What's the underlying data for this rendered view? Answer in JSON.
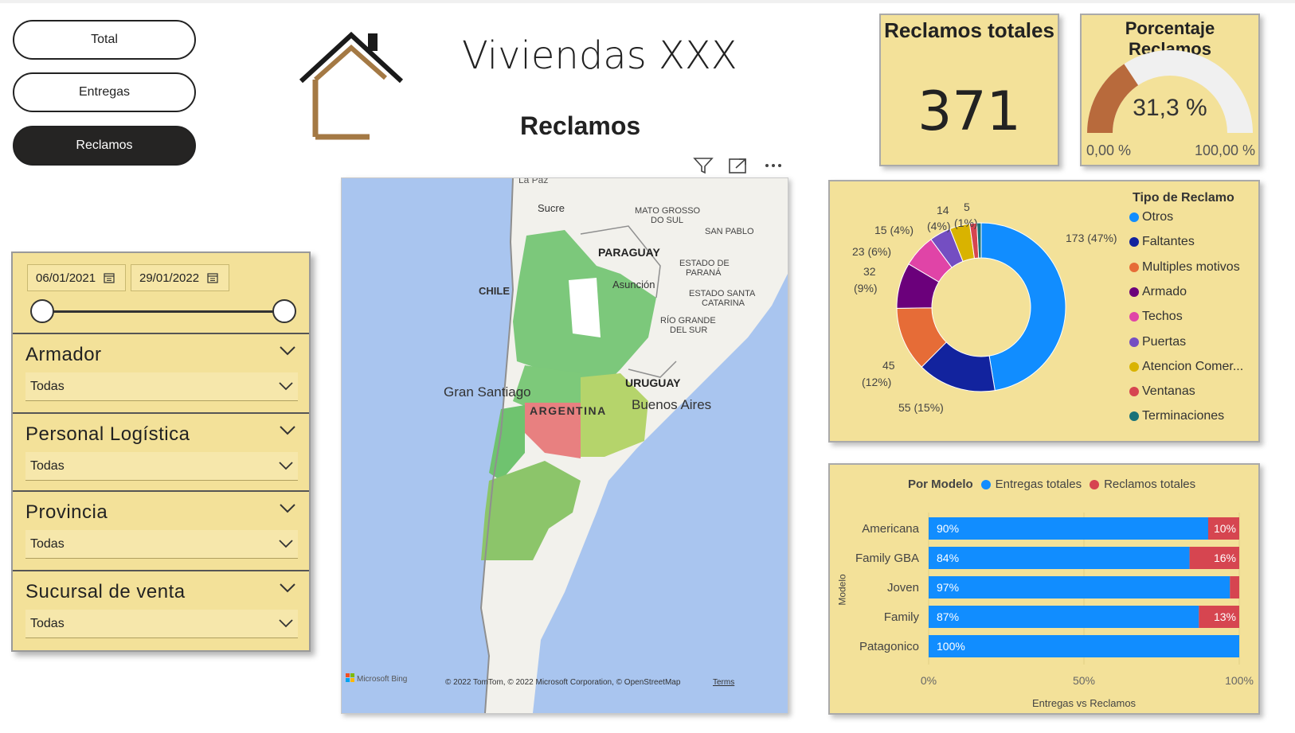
{
  "nav": {
    "total_label": "Total",
    "entregas_label": "Entregas",
    "reclamos_label": "Reclamos"
  },
  "header": {
    "title": "Viviendas XXX",
    "subtitle": "Reclamos"
  },
  "filters": {
    "date_start": "06/01/2021",
    "date_end": "29/01/2022",
    "sections": [
      {
        "label": "Armador",
        "value": "Todas"
      },
      {
        "label": "Personal Logística",
        "value": "Todas"
      },
      {
        "label": "Provincia",
        "value": "Todas"
      },
      {
        "label": "Sucursal de venta",
        "value": "Todas"
      }
    ]
  },
  "map": {
    "labels": {
      "la_paz": "La Paz",
      "sucre": "Sucre",
      "mato_grosso_1": "MATO GROSSO",
      "mato_grosso_2": "DO SUL",
      "san_pablo": "SAN PABLO",
      "paraguay": "PARAGUAY",
      "estado_parana_1": "ESTADO DE",
      "estado_parana_2": "PARANÁ",
      "asuncion": "Asunción",
      "chile": "CHILE",
      "santa_catarina_1": "ESTADO SANTA",
      "santa_catarina_2": "CATARINA",
      "rio_grande_1": "RÍO GRANDE",
      "rio_grande_2": "DEL SUR",
      "uruguay": "URUGUAY",
      "gran_santiago": "Gran Santiago",
      "argentina": "ARGENTINA",
      "buenos_aires": "Buenos Aires",
      "bing": "Microsoft Bing",
      "copyright": "© 2022 TomTom, © 2022 Microsoft Corporation, © OpenStreetMap",
      "terms": "Terms"
    }
  },
  "kpi": {
    "title": "Reclamos totales",
    "value": "371"
  },
  "gauge": {
    "title": "Porcentaje Reclamos",
    "value_label": "31,3 %",
    "value": 0.313,
    "min_label": "0,00 %",
    "max_label": "100,00 %",
    "fill_color": "#b86a3c",
    "track_color": "#f0f0f0"
  },
  "donut": {
    "legend_title": "Tipo de Reclamo",
    "colors": {
      "otros": "#118dff",
      "faltantes": "#12239e",
      "multiples": "#e66c37",
      "armado": "#6b007b",
      "techos": "#e044a7",
      "puertas": "#744ec2",
      "atencion": "#d9b300",
      "ventanas": "#d64550",
      "terminaciones": "#197278"
    },
    "legend": [
      "Otros",
      "Faltantes",
      "Multiples motivos",
      "Armado",
      "Techos",
      "Puertas",
      "Atencion Comer...",
      "Ventanas",
      "Terminaciones"
    ],
    "data_labels": {
      "otros": "173 (47%)",
      "faltantes": "55 (15%)",
      "multiples_1": "45",
      "multiples_2": "(12%)",
      "armado_1": "32",
      "armado_2": "(9%)",
      "techos": "23 (6%)",
      "puertas": "15 (4%)",
      "atencion_1": "14",
      "atencion_2": "(4%)",
      "ventanas_1": "5",
      "ventanas_2": "(1%)"
    }
  },
  "chart_data": {
    "type": "bar",
    "title": "Por Modelo",
    "xlabel": "Entregas vs Reclamos",
    "ylabel": "Modelo",
    "categories": [
      "Americana",
      "Family GBA",
      "Joven",
      "Family",
      "Patagonico"
    ],
    "series": [
      {
        "name": "Entregas totales",
        "values": [
          90,
          84,
          97,
          87,
          100
        ],
        "color": "#118dff"
      },
      {
        "name": "Reclamos totales",
        "values": [
          10,
          16,
          3,
          13,
          0
        ],
        "color": "#d64550"
      }
    ],
    "value_labels": [
      {
        "entregas": "90%",
        "reclamos": "10%"
      },
      {
        "entregas": "84%",
        "reclamos": "16%"
      },
      {
        "entregas": "97%",
        "reclamos": ""
      },
      {
        "entregas": "87%",
        "reclamos": "13%"
      },
      {
        "entregas": "100%",
        "reclamos": ""
      }
    ],
    "xticks": [
      "0%",
      "50%",
      "100%"
    ],
    "xlim": [
      0,
      100
    ],
    "stacked": "100%"
  },
  "donut_chart_data": {
    "type": "pie",
    "title": "Tipo de Reclamo",
    "categories": [
      "Otros",
      "Faltantes",
      "Multiples motivos",
      "Armado",
      "Techos",
      "Puertas",
      "Atencion Comer...",
      "Ventanas",
      "Terminaciones"
    ],
    "values": [
      173,
      55,
      45,
      32,
      23,
      15,
      14,
      5,
      3
    ]
  }
}
